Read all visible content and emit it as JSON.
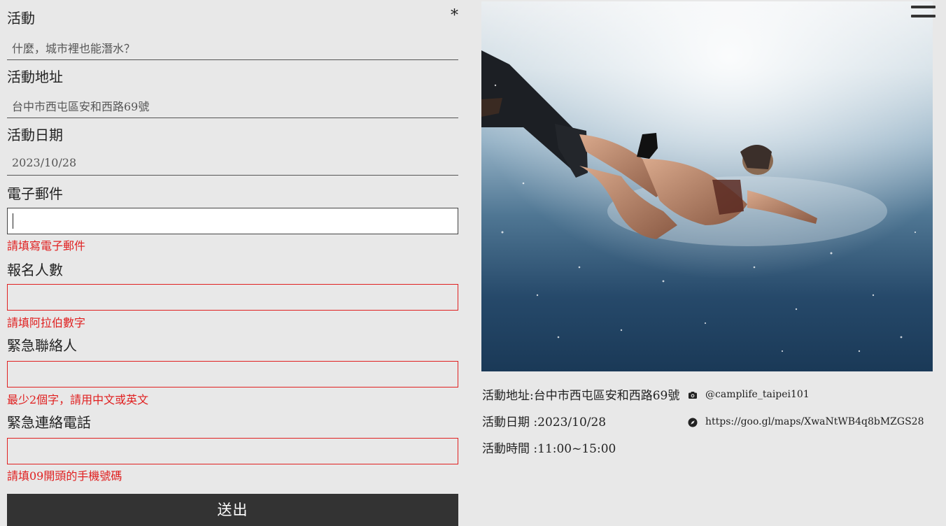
{
  "form": {
    "event": {
      "label": "活動",
      "required_mark": "*",
      "value": "什麼，城市裡也能潛水？"
    },
    "address": {
      "label": "活動地址",
      "value": "台中市西屯區安和西路69號"
    },
    "date": {
      "label": "活動日期",
      "value": "2023/10/28"
    },
    "email": {
      "label": "電子郵件",
      "value": "",
      "error": "請填寫電子郵件"
    },
    "attendees": {
      "label": "報名人數",
      "value": "",
      "error": "請填阿拉伯數字"
    },
    "emergency_contact": {
      "label": "緊急聯絡人",
      "value": "",
      "error": "最少2個字，請用中文或英文"
    },
    "emergency_phone": {
      "label": "緊急連絡電話",
      "value": "",
      "error": "請填09開頭的手機號碼"
    },
    "submit_label": "送出"
  },
  "info": {
    "address": "活動地址:台中市西屯區安和西路69號",
    "date": "活動日期 :2023/10/28",
    "time": "活動時間 :11:00~15:00"
  },
  "social": {
    "instagram": {
      "icon": "camera-icon",
      "text": "@camplife_taipei101"
    },
    "map": {
      "icon": "compass-icon",
      "text": "https://goo.gl/maps/XwaNtWB4q8bMZGS28"
    }
  },
  "colors": {
    "background": "#e8e8e8",
    "error": "#e02020",
    "button": "#333333"
  }
}
